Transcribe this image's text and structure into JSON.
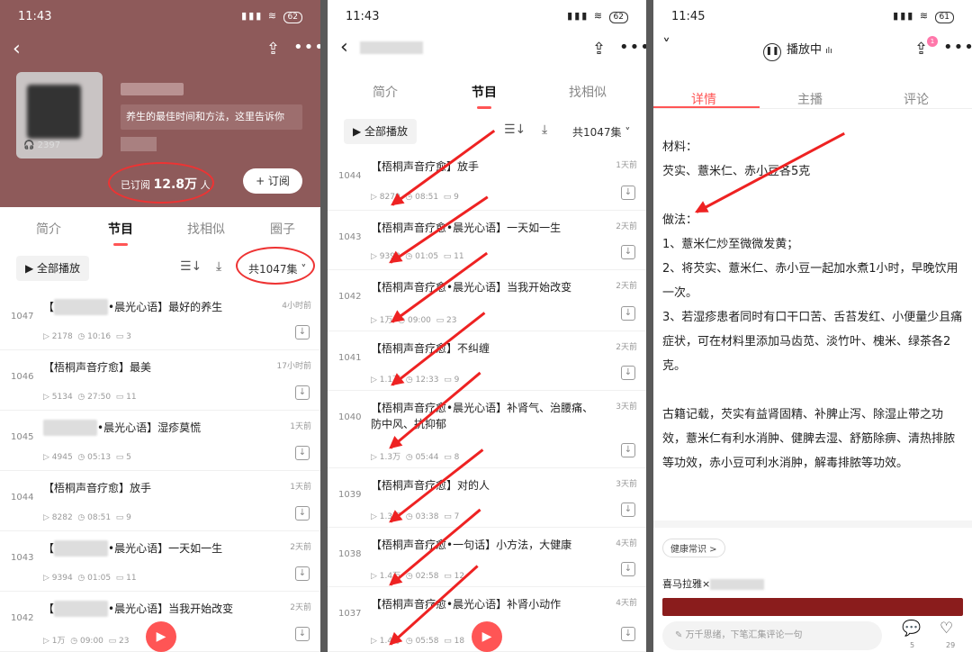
{
  "p1": {
    "time": "11:43",
    "battery": "62",
    "description": "养生的最佳时间和方法，这里告诉你",
    "play_count": "2397",
    "subscribed_prefix": "已订阅",
    "subscribed_count": "12.8万",
    "subscribed_suffix": "人",
    "subscribe_label": "+ 订阅",
    "tabs": [
      "简介",
      "节目",
      "找相似",
      "圈子"
    ],
    "play_all": "全部播放",
    "episode_count": "共1047集",
    "episodes": [
      {
        "num": "1047",
        "title_blur": "梧桐声音疗",
        "title": "•晨光心语】最好的养生",
        "prefix": "【",
        "ago": "4小时前",
        "plays": "2178",
        "duration": "10:16",
        "comments": "3"
      },
      {
        "num": "1046",
        "title_blur": "",
        "title": "【梧桐声音疗愈】最美",
        "prefix": "",
        "ago": "17小时前",
        "plays": "5134",
        "duration": "27:50",
        "comments": "11"
      },
      {
        "num": "1045",
        "title_blur": "梧桐声音疗",
        "title": "•晨光心语】湿疹莫慌",
        "prefix": "",
        "ago": "1天前",
        "plays": "4945",
        "duration": "05:13",
        "comments": "5"
      },
      {
        "num": "1044",
        "title_blur": "",
        "title": "【梧桐声音疗愈】放手",
        "prefix": "",
        "ago": "1天前",
        "plays": "8282",
        "duration": "08:51",
        "comments": "9"
      },
      {
        "num": "1043",
        "title_blur": "梧桐声音疗",
        "title": "•晨光心语】一天如一生",
        "prefix": "【",
        "ago": "2天前",
        "plays": "9394",
        "duration": "01:05",
        "comments": "11"
      },
      {
        "num": "1042",
        "title_blur": "梧桐声音疗",
        "title": "•晨光心语】当我开始改变",
        "prefix": "【",
        "ago": "2天前",
        "plays": "1万",
        "duration": "09:00",
        "comments": "23"
      }
    ]
  },
  "p2": {
    "time": "11:43",
    "battery": "62",
    "tabs": [
      "简介",
      "节目",
      "找相似"
    ],
    "play_all": "全部播放",
    "episode_count": "共1047集",
    "episodes": [
      {
        "num": "1044",
        "title": "【梧桐声音疗愈】放手",
        "ago": "1天前",
        "plays": "8279",
        "duration": "08:51",
        "comments": "9"
      },
      {
        "num": "1043",
        "title": "【梧桐声音疗愈•晨光心语】一天如一生",
        "ago": "2天前",
        "plays": "9393",
        "duration": "01:05",
        "comments": "11"
      },
      {
        "num": "1042",
        "title": "【梧桐声音疗愈•晨光心语】当我开始改变",
        "ago": "2天前",
        "plays": "1万",
        "duration": "09:00",
        "comments": "23"
      },
      {
        "num": "1041",
        "title": "【梧桐声音疗愈】不纠缠",
        "ago": "2天前",
        "plays": "1.1万",
        "duration": "12:33",
        "comments": "9"
      },
      {
        "num": "1040",
        "title": "【梧桐声音疗愈•晨光心语】补肾气、治腰痛、防中风、抗抑郁",
        "ago": "3天前",
        "plays": "1.3万",
        "duration": "05:44",
        "comments": "8"
      },
      {
        "num": "1039",
        "title": "【梧桐声音疗愈】对的人",
        "ago": "3天前",
        "plays": "1.3万",
        "duration": "03:38",
        "comments": "7"
      },
      {
        "num": "1038",
        "title": "【梧桐声音疗愈•一句话】小方法，大健康",
        "ago": "4天前",
        "plays": "1.4万",
        "duration": "02:58",
        "comments": "12"
      },
      {
        "num": "1037",
        "title": "【梧桐声音疗愈•晨光心语】补肾小动作",
        "ago": "4天前",
        "plays": "1.4万",
        "duration": "05:58",
        "comments": "18"
      }
    ]
  },
  "p3": {
    "time": "11:45",
    "battery": "61",
    "playing": "播放中",
    "share_badge": "1",
    "tabs": [
      "详情",
      "主播",
      "评论"
    ],
    "article": [
      "材料：",
      "芡实、薏米仁、赤小豆各5克",
      "",
      "做法：",
      "1、薏米仁炒至微微发黄；",
      "2、将芡实、薏米仁、赤小豆一起加水煮1小时，早晚饮用一次。",
      "3、若湿疹患者同时有口干口苦、舌苔发红、小便量少且痛症状，可在材料里添加马齿苋、淡竹叶、槐米、绿茶各2克。",
      "",
      "古籍记载，芡实有益肾固精、补脾止泻、除湿止带之功效，薏米仁有利水消肿、健脾去湿、舒筋除痹、清热排脓等功效，赤小豆可利水消肿，解毒排脓等功效。"
    ],
    "tag": "健康常识 >",
    "brand": "喜马拉雅×",
    "comment_placeholder": "万千思绪，下笔汇集评论一句",
    "comment_count": "5",
    "like_count": "29"
  }
}
